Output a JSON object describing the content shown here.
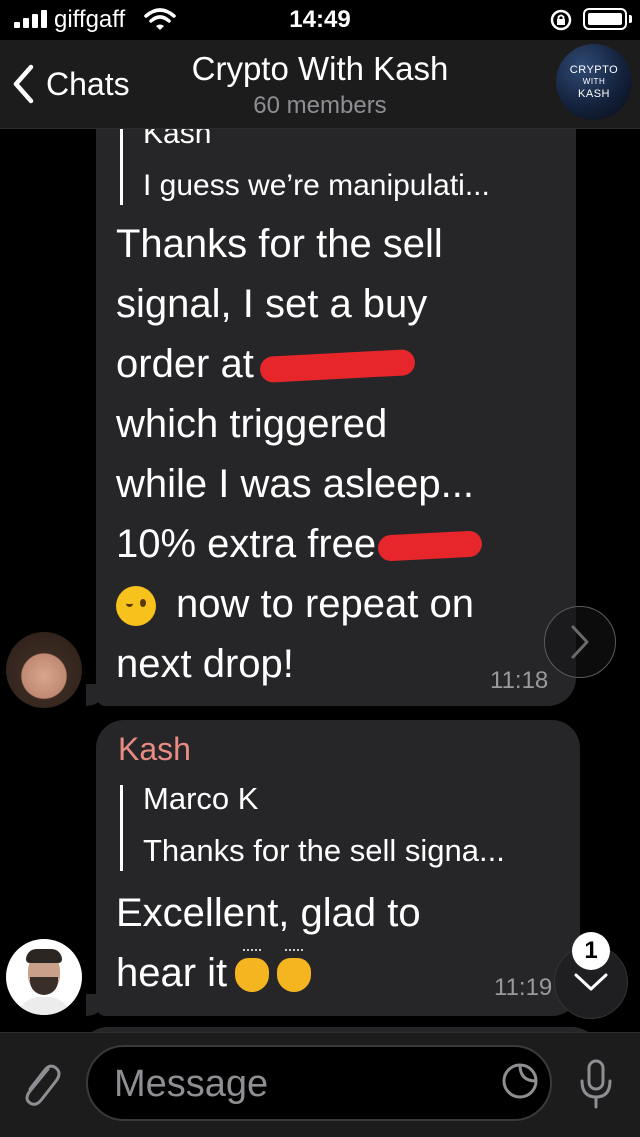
{
  "status_bar": {
    "carrier": "giffgaff",
    "time": "14:49",
    "icons": [
      "signal-icon",
      "wifi-icon",
      "rotation-lock-icon",
      "battery-icon"
    ]
  },
  "header": {
    "back_label": "Chats",
    "title": "Crypto With Kash",
    "subtitle": "60 members",
    "avatar_text": {
      "line1": "CRYPTO",
      "line2": "WITH",
      "line3": "KASH"
    }
  },
  "messages": [
    {
      "reply": {
        "name": "Kash",
        "text": "I guess we’re manipulati..."
      },
      "lines": {
        "l1": "Thanks for the sell",
        "l2": "signal, I set a buy",
        "l3": "order at",
        "l4": "which triggered",
        "l5": "while I was asleep...",
        "l6": "10% extra free",
        "l7": "now to repeat on",
        "l8": "next drop!"
      },
      "time": "11:18"
    },
    {
      "sender": "Kash",
      "reply": {
        "name": "Marco K",
        "text": "Thanks for the sell signa..."
      },
      "lines": {
        "l1": "Excellent, glad to",
        "l2": "hear it"
      },
      "time": "11:19"
    }
  ],
  "scroll_badge": "1",
  "composer": {
    "placeholder": "Message"
  },
  "colors": {
    "background": "#000000",
    "bubble": "#262628",
    "header": "#1c1c1d",
    "sender_name": "#e88b82",
    "redaction": "#e6262a"
  }
}
